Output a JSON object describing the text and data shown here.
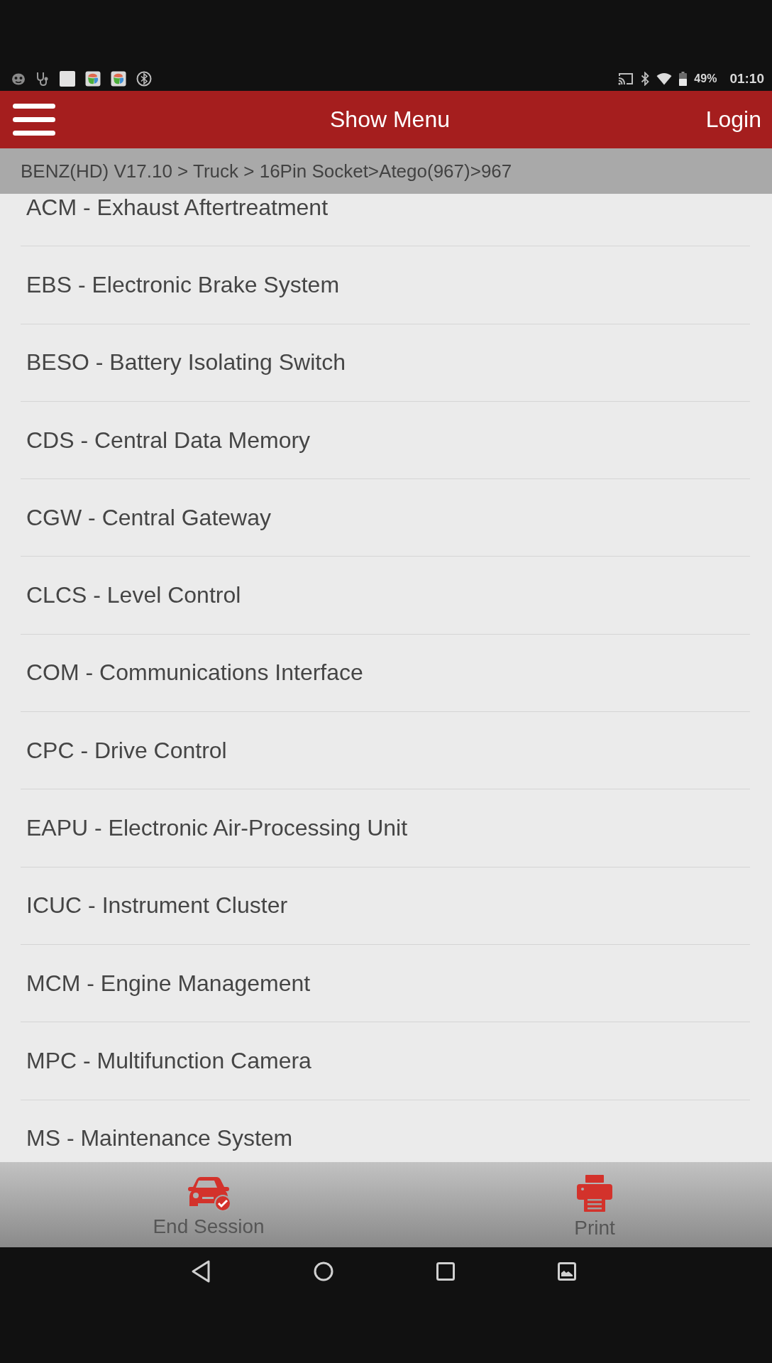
{
  "status_bar": {
    "battery": "49%",
    "time": "01:10"
  },
  "header": {
    "title": "Show Menu",
    "action": "Login"
  },
  "breadcrumb": "BENZ(HD) V17.10 > Truck > 16Pin Socket>Atego(967)>967",
  "menu_items": [
    "ACM - Exhaust Aftertreatment",
    "EBS - Electronic Brake System",
    "BESO - Battery Isolating Switch",
    "CDS - Central Data Memory",
    "CGW - Central Gateway",
    "CLCS - Level Control",
    "COM - Communications Interface",
    "CPC - Drive Control",
    "EAPU - Electronic Air-Processing Unit",
    "ICUC - Instrument Cluster",
    "MCM - Engine Management",
    "MPC - Multifunction Camera",
    "MS - Maintenance System"
  ],
  "bottom_bar": [
    {
      "kind": "end_session",
      "label": "End Session"
    },
    {
      "kind": "print",
      "label": "Print"
    }
  ]
}
